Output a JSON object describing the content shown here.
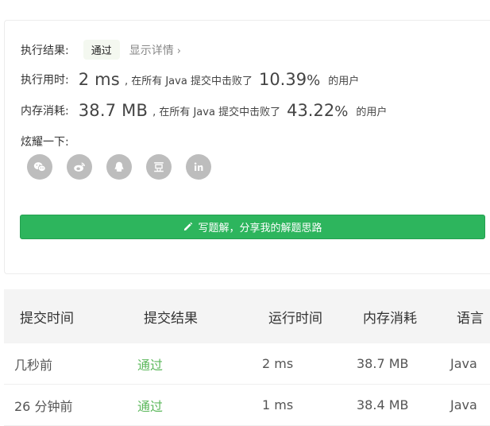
{
  "result": {
    "exec_result_label": "执行结果:",
    "status": "通过",
    "detail_link": "显示详情",
    "runtime_label": "执行用时:",
    "runtime_value": "2 ms",
    "runtime_prefix": ", 在所有 Java 提交中击败了",
    "runtime_percent": "10.39",
    "runtime_percent_sign": "%",
    "runtime_suffix": "的用户",
    "memory_label": "内存消耗:",
    "memory_value": "38.7 MB",
    "memory_prefix": ", 在所有 Java 提交中击败了",
    "memory_percent": "43.22",
    "memory_percent_sign": "%",
    "memory_suffix": "的用户",
    "share_label": "炫耀一下:",
    "share_icons": [
      "wechat-icon",
      "weibo-icon",
      "qq-icon",
      "douban-icon",
      "linkedin-icon"
    ],
    "solution_button": "写题解，分享我的解题思路"
  },
  "table": {
    "headers": [
      "提交时间",
      "提交结果",
      "运行时间",
      "内存消耗",
      "语言"
    ],
    "rows": [
      [
        "几秒前",
        "通过",
        "2 ms",
        "38.7 MB",
        "Java"
      ],
      [
        "26 分钟前",
        "通过",
        "1 ms",
        "38.4 MB",
        "Java"
      ]
    ]
  },
  "colors": {
    "accent_green": "#2db55d",
    "pass_text": "#5cb85c"
  }
}
